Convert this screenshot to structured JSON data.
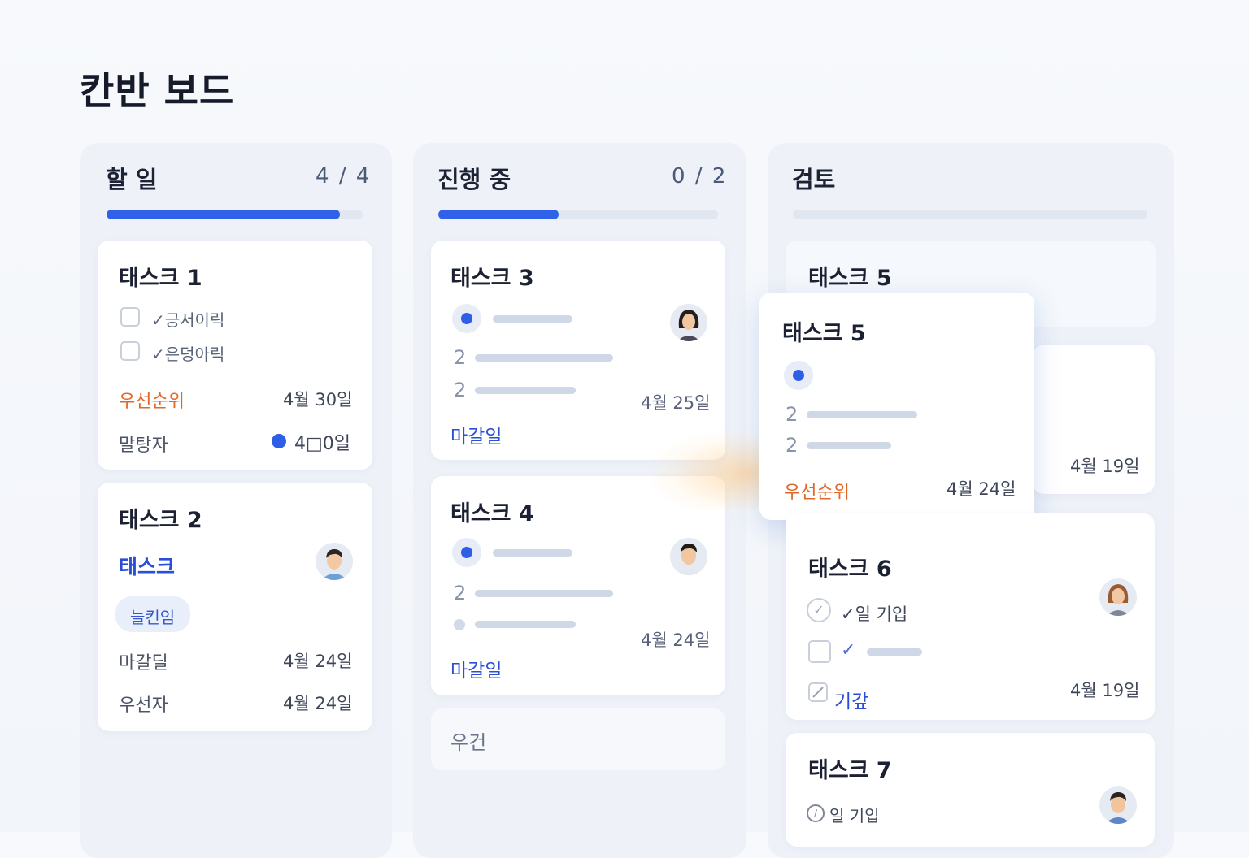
{
  "page": {
    "title": "칸반 보드"
  },
  "columns": {
    "todo": {
      "title": "할 일",
      "count": "4 / 4",
      "progress": 0.91
    },
    "progress": {
      "title": "진행 중",
      "count": "0 / 2",
      "progress": 0.43
    },
    "review": {
      "title": "검토",
      "progress": 0.0
    }
  },
  "cards": {
    "task1": {
      "title": "태스크 1",
      "checks": [
        "✓긍서이릭",
        "✓은덩아릭"
      ],
      "priority_label": "우선순위",
      "priority_date": "4월 30일",
      "assignee_label": "말탕자",
      "assignee_date": "4□0일"
    },
    "task2": {
      "title": "태스크 2",
      "subtitle": "태스크",
      "tag": "늘킨임",
      "due_label": "마갈딜",
      "due_date": "4월 24일",
      "owner_label": "우선자",
      "owner_date": "4월 24일"
    },
    "task3": {
      "title": "태스크 3",
      "nums": [
        "2",
        "2"
      ],
      "date": "4월 25일",
      "link": "마갈일"
    },
    "task4": {
      "title": "태스크 4",
      "nums": [
        "2"
      ],
      "date": "4월 24일",
      "link": "마갈일"
    },
    "add_card": {
      "label": "우건"
    },
    "task5_ghost": {
      "title": "태스크 5"
    },
    "task5_back": {
      "date": "4월 19일"
    },
    "task5_drag": {
      "title": "태스크 5",
      "nums": [
        "2",
        "2"
      ],
      "priority_label": "우선순위",
      "date": "4월 24일"
    },
    "task6": {
      "title": "태스크 6",
      "check1": "✓일 기입",
      "check2": "✓",
      "link": "기갚",
      "date": "4월 19일"
    },
    "task7": {
      "title": "태스크 7",
      "check1": "일 기입"
    }
  },
  "colors": {
    "accent": "#2f62e8",
    "priority": "#e2682a",
    "link": "#2a4fd6"
  },
  "icons": [
    "checkbox-icon",
    "check-icon",
    "avatar-icon",
    "dot-icon",
    "check-circle-icon",
    "edit-icon"
  ]
}
